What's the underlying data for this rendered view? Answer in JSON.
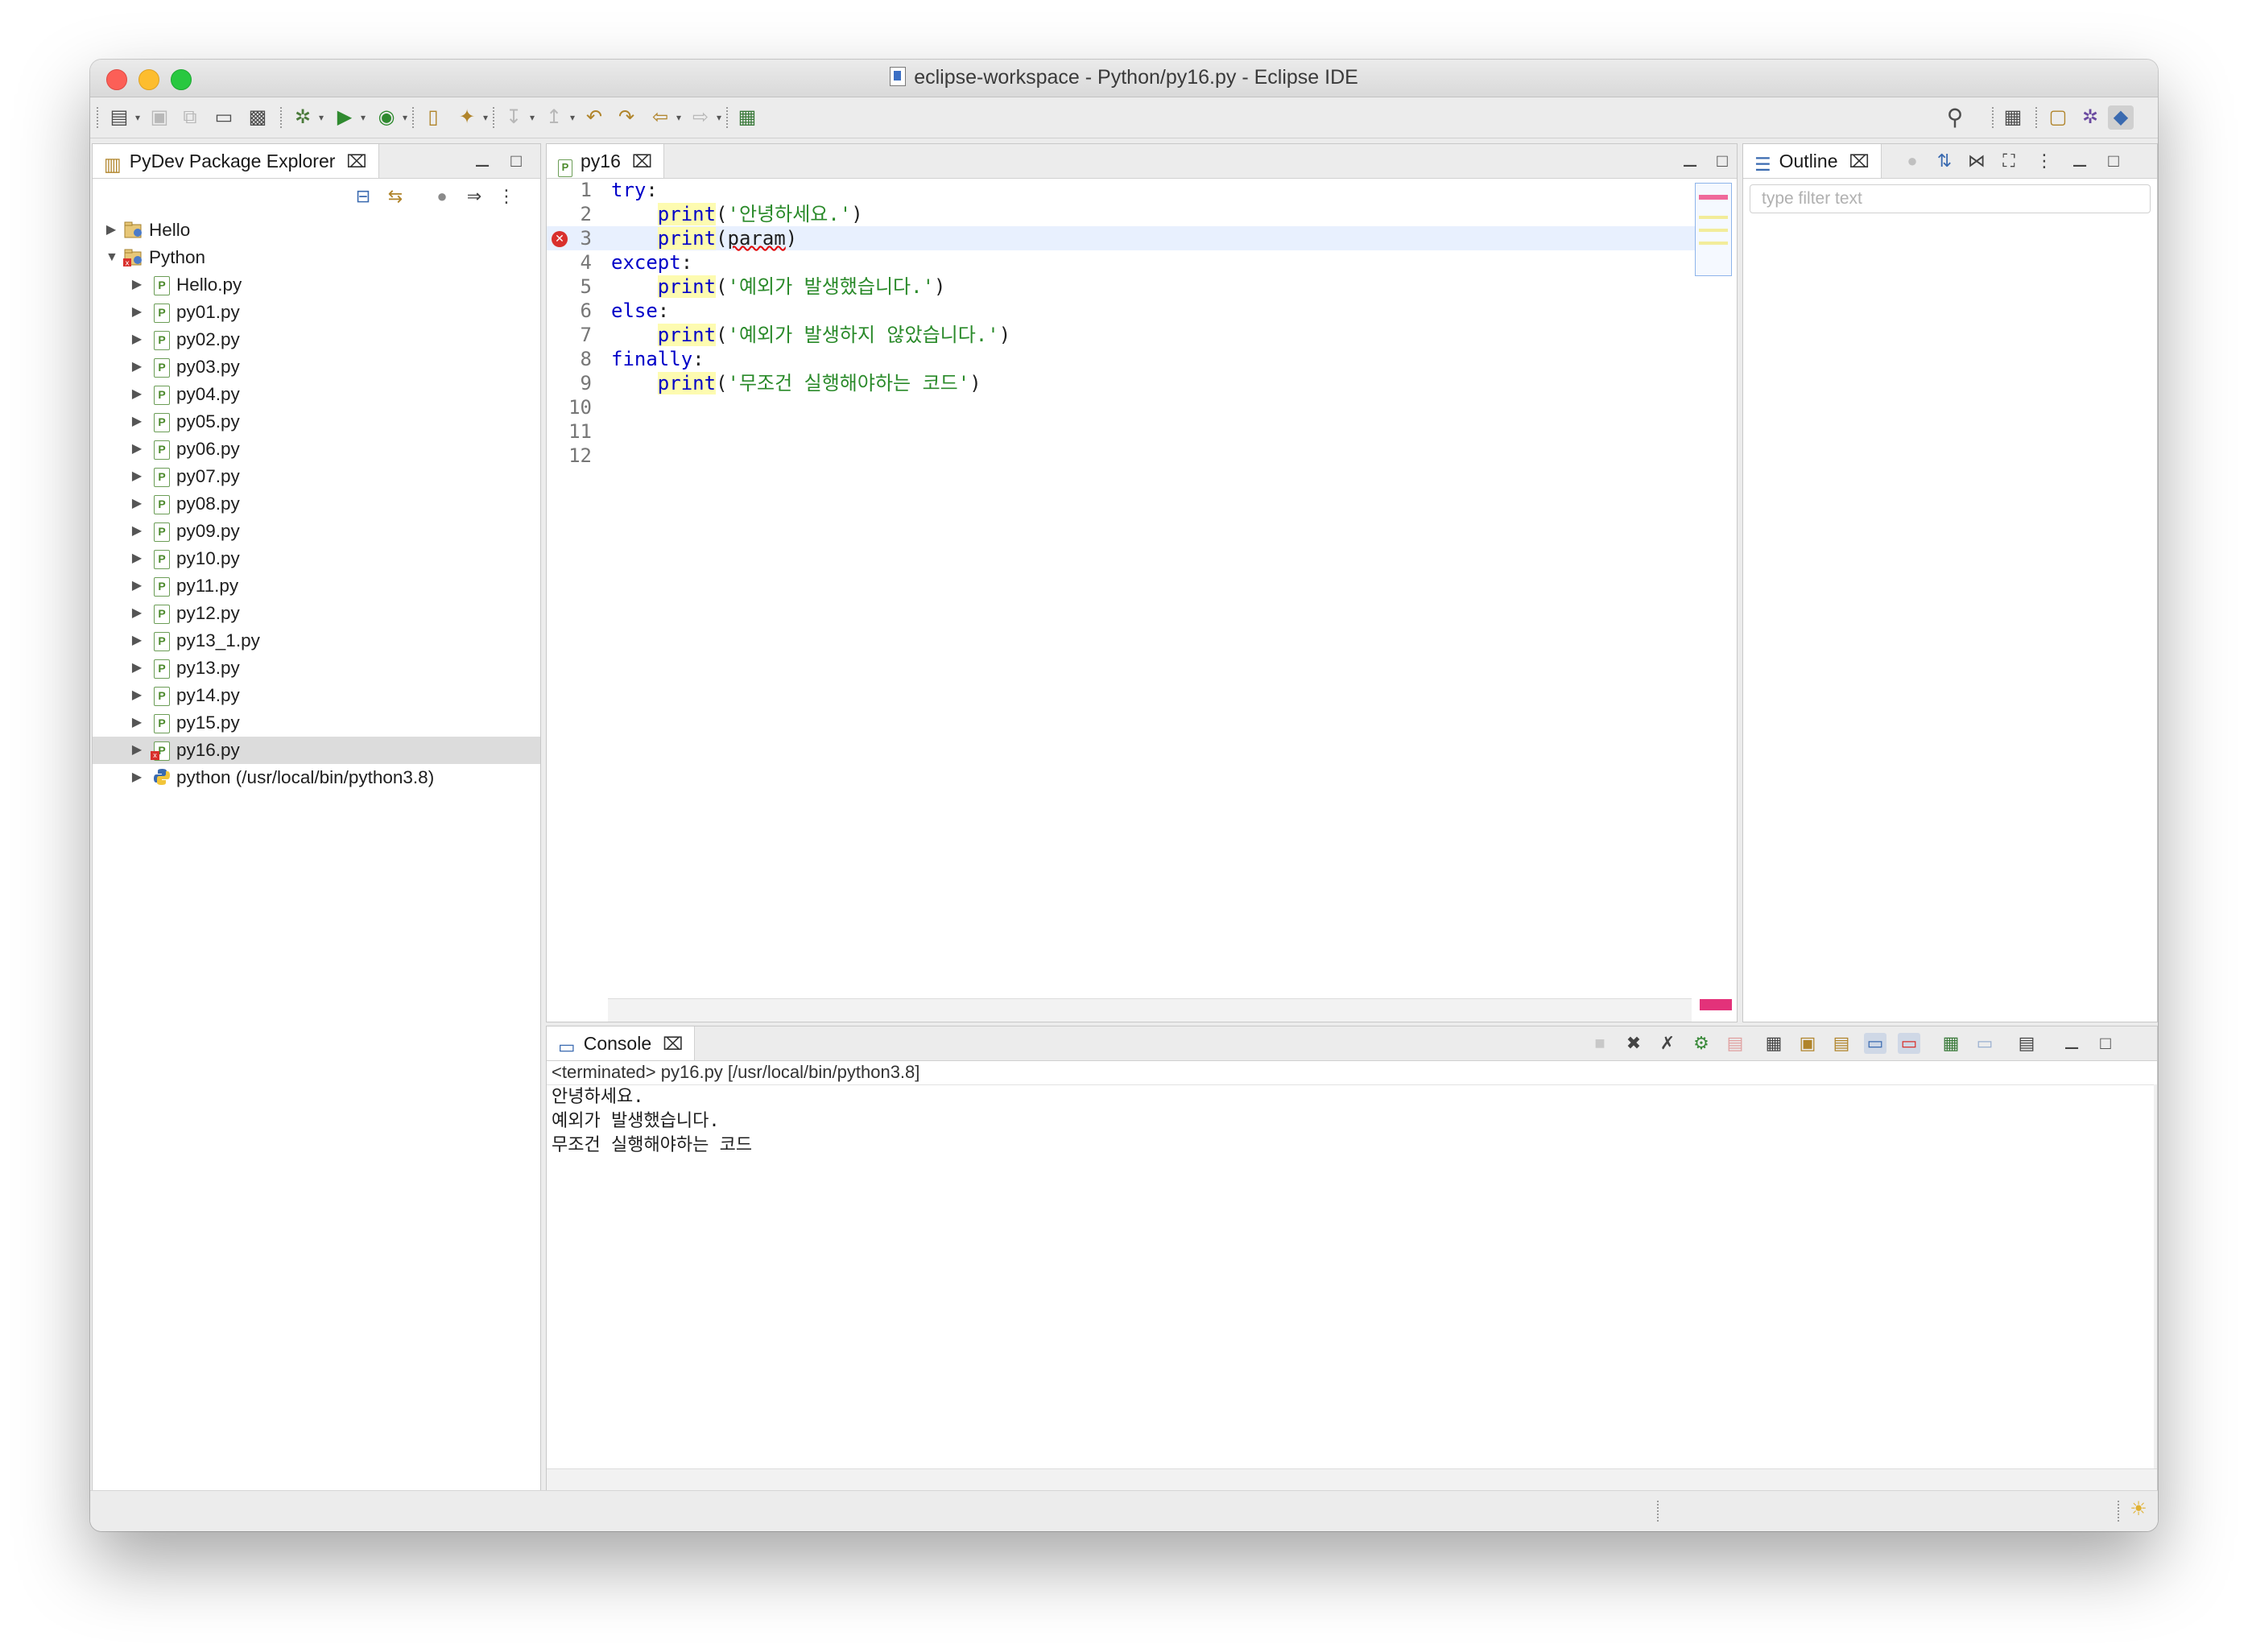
{
  "window": {
    "title": "eclipse-workspace - Python/py16.py - Eclipse IDE"
  },
  "toolbar": {
    "left_icons": [
      "new-icon",
      "save-icon",
      "save-all-icon",
      "terminal-icon",
      "package-icon",
      "debug-icon",
      "run-icon",
      "coverage-icon",
      "open-folder-icon",
      "wand-icon",
      "next-annotation-icon",
      "prev-annotation-icon",
      "last-edit-icon",
      "back-icon",
      "forward-icon",
      "open-perspective-task-icon"
    ],
    "right_icons": [
      "search-icon",
      "open-perspective-icon",
      "pydev-perspective-icon",
      "debug-perspective-icon",
      "python-perspective-icon"
    ]
  },
  "explorer": {
    "tab_label": "PyDev Package Explorer",
    "projects": [
      {
        "label": "Hello",
        "expanded": false
      },
      {
        "label": "Python",
        "expanded": true,
        "has_error": true
      }
    ],
    "files": [
      "Hello.py",
      "py01.py",
      "py02.py",
      "py03.py",
      "py04.py",
      "py05.py",
      "py06.py",
      "py07.py",
      "py08.py",
      "py09.py",
      "py10.py",
      "py11.py",
      "py12.py",
      "py13_1.py",
      "py13.py",
      "py14.py",
      "py15.py",
      "py16.py"
    ],
    "selected_file": "py16.py",
    "interpreter": "python  (/usr/local/bin/python3.8)"
  },
  "editor": {
    "tab_label": "py16",
    "error_line": 3,
    "current_line": 3,
    "lines": [
      {
        "n": "1",
        "parts": [
          {
            "t": "try",
            "c": "kw"
          },
          {
            "t": ":",
            "c": ""
          }
        ]
      },
      {
        "n": "2",
        "parts": [
          {
            "t": "    ",
            "c": ""
          },
          {
            "t": "print",
            "c": "fn"
          },
          {
            "t": "(",
            "c": ""
          },
          {
            "t": "'안녕하세요.'",
            "c": "st"
          },
          {
            "t": ")",
            "c": ""
          }
        ]
      },
      {
        "n": "3",
        "parts": [
          {
            "t": "    ",
            "c": ""
          },
          {
            "t": "print",
            "c": "fn"
          },
          {
            "t": "(",
            "c": ""
          },
          {
            "t": "param",
            "c": "err"
          },
          {
            "t": ")",
            "c": ""
          }
        ]
      },
      {
        "n": "4",
        "parts": [
          {
            "t": "except",
            "c": "kw"
          },
          {
            "t": ":",
            "c": ""
          }
        ]
      },
      {
        "n": "5",
        "parts": [
          {
            "t": "    ",
            "c": ""
          },
          {
            "t": "print",
            "c": "fn"
          },
          {
            "t": "(",
            "c": ""
          },
          {
            "t": "'예외가 발생했습니다.'",
            "c": "st"
          },
          {
            "t": ")",
            "c": ""
          }
        ]
      },
      {
        "n": "6",
        "parts": [
          {
            "t": "else",
            "c": "kw"
          },
          {
            "t": ":",
            "c": ""
          }
        ]
      },
      {
        "n": "7",
        "parts": [
          {
            "t": "    ",
            "c": ""
          },
          {
            "t": "print",
            "c": "fn"
          },
          {
            "t": "(",
            "c": ""
          },
          {
            "t": "'예외가 발생하지 않았습니다.'",
            "c": "st"
          },
          {
            "t": ")",
            "c": ""
          }
        ]
      },
      {
        "n": "8",
        "parts": [
          {
            "t": "finally",
            "c": "kw"
          },
          {
            "t": ":",
            "c": ""
          }
        ]
      },
      {
        "n": "9",
        "parts": [
          {
            "t": "    ",
            "c": ""
          },
          {
            "t": "print",
            "c": "fn"
          },
          {
            "t": "(",
            "c": ""
          },
          {
            "t": "'무조건 실행해야하는 코드'",
            "c": "st"
          },
          {
            "t": ")",
            "c": ""
          }
        ]
      },
      {
        "n": "10",
        "parts": []
      },
      {
        "n": "11",
        "parts": []
      },
      {
        "n": "12",
        "parts": []
      }
    ]
  },
  "outline": {
    "tab_label": "Outline",
    "filter_placeholder": "type filter text"
  },
  "console": {
    "tab_label": "Console",
    "header": "<terminated> py16.py [/usr/local/bin/python3.8]",
    "output": [
      "안녕하세요.",
      "예외가 발생했습니다.",
      "무조건 실행해야하는 코드"
    ]
  },
  "colors": {
    "keyword": "#0000c8",
    "string": "#2a8a2a",
    "occurrence_highlight": "#fdfbb0",
    "error": "#d9302c",
    "current_line": "#e8f0fe"
  }
}
